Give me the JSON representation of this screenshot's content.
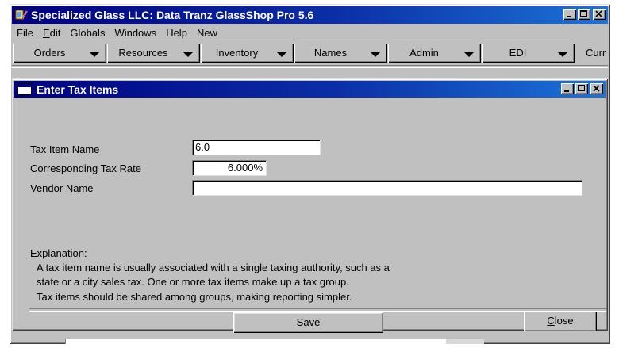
{
  "app": {
    "title": "Specialized Glass LLC: Data Tranz GlassShop Pro 5.6",
    "icon": "app-icon"
  },
  "menubar": {
    "items": [
      {
        "label": "File"
      },
      {
        "label": "Edit"
      },
      {
        "label": "Globals"
      },
      {
        "label": "Windows"
      },
      {
        "label": "Help"
      },
      {
        "label": "New"
      }
    ]
  },
  "toolbar": {
    "buttons": [
      {
        "label": "Orders"
      },
      {
        "label": "Resources"
      },
      {
        "label": "Inventory"
      },
      {
        "label": "Names"
      },
      {
        "label": "Admin"
      },
      {
        "label": "EDI"
      }
    ],
    "overflow_text": "Curr"
  },
  "dialog": {
    "title": "Enter Tax Items",
    "fields": {
      "tax_item_name": {
        "label": "Tax Item Name",
        "value": "6.0"
      },
      "tax_rate": {
        "label": "Corresponding  Tax Rate",
        "value": "6.000%"
      },
      "vendor_name": {
        "label": "Vendor Name",
        "value": ""
      }
    },
    "explanation": {
      "heading": "Explanation:",
      "lines": [
        "A tax item name is usually associated with a single taxing authority, such as a",
        "state or a city sales tax.  One or more tax items make up a tax group.",
        "Tax items should be shared among groups, making reporting simpler."
      ]
    },
    "buttons": {
      "save": "Save",
      "close": "Close"
    }
  },
  "colors": {
    "titlebar_start": "#000080",
    "titlebar_end": "#1d73d8",
    "face": "#c0c0c0"
  }
}
